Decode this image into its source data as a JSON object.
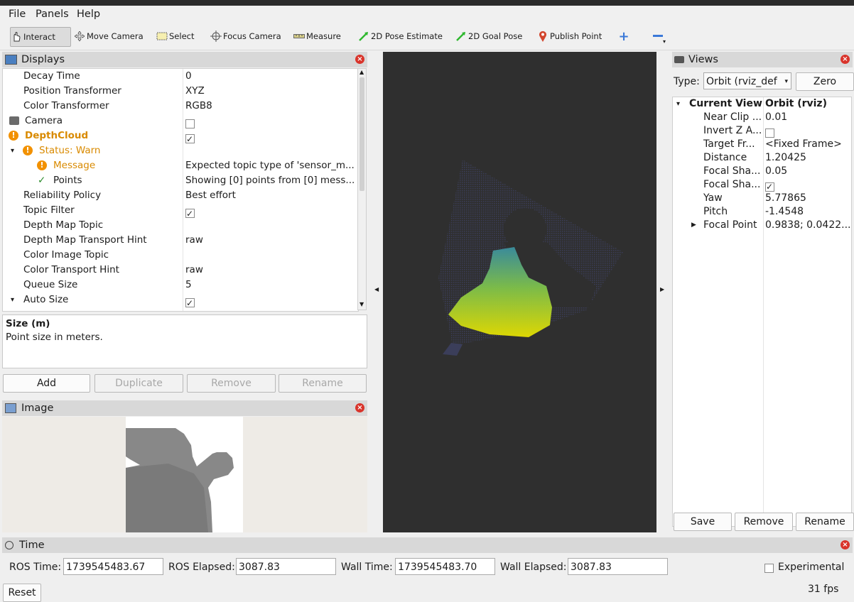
{
  "menu": {
    "file": "File",
    "panels": "Panels",
    "help": "Help"
  },
  "toolbar": {
    "interact": "Interact",
    "move_camera": "Move Camera",
    "select": "Select",
    "focus_camera": "Focus Camera",
    "measure": "Measure",
    "pose_estimate": "2D Pose Estimate",
    "goal_pose": "2D Goal Pose",
    "publish_point": "Publish Point"
  },
  "displays": {
    "title": "Displays",
    "rows": [
      {
        "label": "Decay Time",
        "value": "0"
      },
      {
        "label": "Position Transformer",
        "value": "XYZ"
      },
      {
        "label": "Color Transformer",
        "value": "RGB8"
      },
      {
        "label": "Camera",
        "value": ""
      },
      {
        "label": "DepthCloud",
        "value": ""
      },
      {
        "label": "Status: Warn",
        "value": ""
      },
      {
        "label": "Message",
        "value": "Expected topic type of 'sensor_m..."
      },
      {
        "label": "Points",
        "value": "Showing [0] points from [0] mess..."
      },
      {
        "label": "Reliability Policy",
        "value": "Best effort"
      },
      {
        "label": "Topic Filter",
        "value": ""
      },
      {
        "label": "Depth Map Topic",
        "value": ""
      },
      {
        "label": "Depth Map Transport Hint",
        "value": "raw"
      },
      {
        "label": "Color Image Topic",
        "value": ""
      },
      {
        "label": "Color Transport Hint",
        "value": "raw"
      },
      {
        "label": "Queue Size",
        "value": "5"
      },
      {
        "label": "Auto Size",
        "value": ""
      }
    ],
    "camera_checked": false,
    "depthcloud_checked": true,
    "topic_filter_checked": true,
    "auto_size_checked": true
  },
  "description": {
    "title": "Size (m)",
    "text": "Point size in meters."
  },
  "display_buttons": {
    "add": "Add",
    "duplicate": "Duplicate",
    "remove": "Remove",
    "rename": "Rename"
  },
  "image_panel": {
    "title": "Image"
  },
  "views": {
    "title": "Views",
    "type_label": "Type:",
    "type_value": "Orbit (rviz_def",
    "zero": "Zero",
    "current_view": "Current View",
    "current_view_value": "Orbit (rviz)",
    "props": [
      {
        "label": "Near Clip ...",
        "value": "0.01"
      },
      {
        "label": "Invert Z A...",
        "value": ""
      },
      {
        "label": "Target Fr...",
        "value": "<Fixed Frame>"
      },
      {
        "label": "Distance",
        "value": "1.20425"
      },
      {
        "label": "Focal Sha...",
        "value": "0.05"
      },
      {
        "label": "Focal Sha...",
        "value": ""
      },
      {
        "label": "Yaw",
        "value": "5.77865"
      },
      {
        "label": "Pitch",
        "value": "-1.4548"
      },
      {
        "label": "Focal Point",
        "value": "0.9838; 0.0422..."
      }
    ],
    "invert_z_checked": false,
    "focal_shape_fixed_checked": true,
    "save": "Save",
    "remove": "Remove",
    "rename": "Rename"
  },
  "time": {
    "title": "Time",
    "ros_time_label": "ROS Time:",
    "ros_time": "1739545483.67",
    "ros_elapsed_label": "ROS Elapsed:",
    "ros_elapsed": "3087.83",
    "wall_time_label": "Wall Time:",
    "wall_time": "1739545483.70",
    "wall_elapsed_label": "Wall Elapsed:",
    "wall_elapsed": "3087.83",
    "experimental": "Experimental",
    "experimental_checked": false,
    "reset": "Reset",
    "fps": "31 fps"
  },
  "colors": {
    "warn": "#f29100",
    "viewport": "#2f2f2f",
    "close": "#d9342b",
    "point_yellow": "#e6e000",
    "point_green": "#7fc24a"
  }
}
